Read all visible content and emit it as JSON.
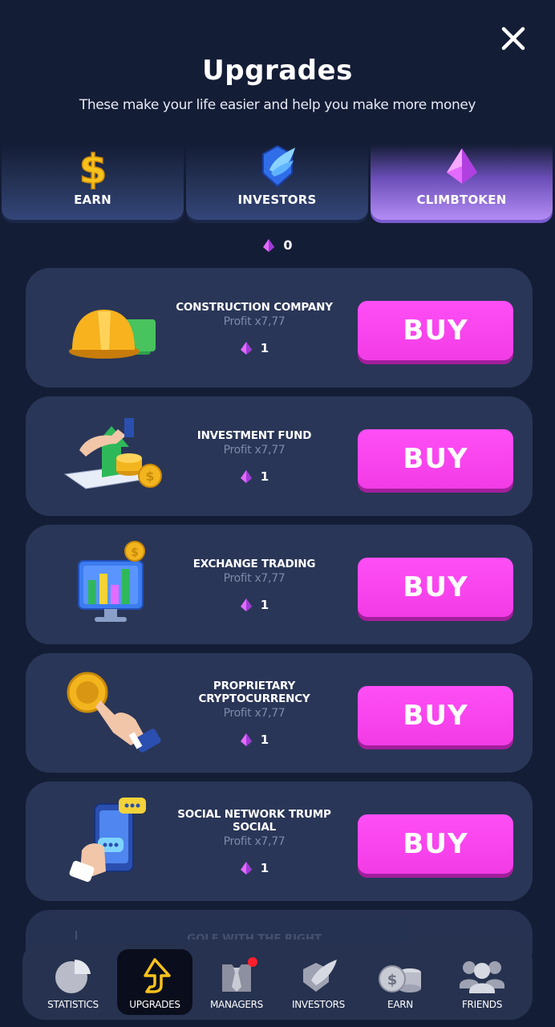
{
  "header": {
    "title": "Upgrades",
    "subtitle": "These make your life easier and help you make more money",
    "close_icon": "close-icon"
  },
  "tabs": [
    {
      "label": "EARN",
      "icon": "dollar-icon",
      "active": false
    },
    {
      "label": "INVESTORS",
      "icon": "winged-shield-icon",
      "active": false
    },
    {
      "label": "CLIMBTOKEN",
      "icon": "gem-icon",
      "active": true
    }
  ],
  "balance": {
    "value": "0",
    "icon": "gem-icon"
  },
  "upgrades": [
    {
      "name": "CONSTRUCTION COMPANY",
      "profit": "Profit x7,77",
      "price": "1",
      "buy_label": "BUY",
      "icon": "hard-hat-icon"
    },
    {
      "name": "INVESTMENT FUND",
      "profit": "Profit x7,77",
      "price": "1",
      "buy_label": "BUY",
      "icon": "investment-growth-icon"
    },
    {
      "name": "EXCHANGE TRADING",
      "profit": "Profit x7,77",
      "price": "1",
      "buy_label": "BUY",
      "icon": "trading-monitor-icon"
    },
    {
      "name": "PROPRIETARY CRYPTOCURRENCY",
      "profit": "Profit x7,77",
      "price": "1",
      "buy_label": "BUY",
      "icon": "crypto-coin-hand-icon"
    },
    {
      "name": "SOCIAL NETWORK TRUMP SOCIAL",
      "profit": "Profit x7,77",
      "price": "1",
      "buy_label": "BUY",
      "icon": "social-phone-icon"
    },
    {
      "name": "GOLF WITH THE RIGHT",
      "icon": "golf-icon"
    }
  ],
  "nav": [
    {
      "label": "STATISTICS",
      "icon": "pie-chart-icon",
      "active": false
    },
    {
      "label": "UPGRADES",
      "icon": "upgrade-arrow-icon",
      "active": true
    },
    {
      "label": "MANAGERS",
      "icon": "manager-tie-icon",
      "active": false,
      "badge": true
    },
    {
      "label": "INVESTORS",
      "icon": "winged-shield-icon",
      "active": false
    },
    {
      "label": "EARN",
      "icon": "coins-icon",
      "active": false
    },
    {
      "label": "FRIENDS",
      "icon": "friends-icon",
      "active": false
    }
  ],
  "colors": {
    "background": "#141d36",
    "card": "#2a3657",
    "buy_button": "#f23ce6",
    "active_tab": "#b48cf5",
    "badge": "#ff1f2d"
  }
}
